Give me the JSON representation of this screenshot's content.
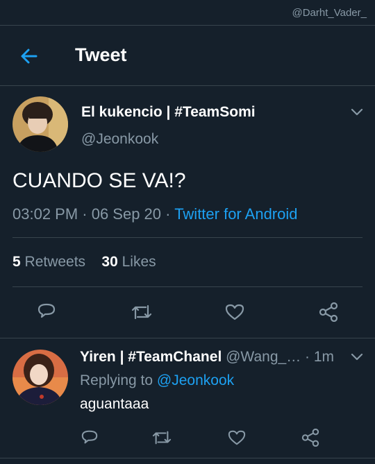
{
  "watermark": "@Darht_Vader_",
  "header": {
    "title": "Tweet"
  },
  "tweet": {
    "author_name": "El kukencio | #TeamSomi",
    "author_handle": "@Jeonkook",
    "text": "CUANDO SE VA!?",
    "timestamp": "03:02 PM · 06 Sep 20 · ",
    "client": "Twitter for Android",
    "retweets_count": "5",
    "retweets_label": " Retweets",
    "likes_count": "30",
    "likes_label": " Likes"
  },
  "reply": {
    "author_name": "Yiren | #TeamChanel",
    "author_handle": " @Wang_…",
    "time": " · 1m",
    "replying_prefix": "Replying to ",
    "replying_to": "@Jeonkook",
    "text": "aguantaaa"
  },
  "icons": {
    "back": "arrow-left-icon",
    "more": "chevron-down-icon",
    "reply": "reply-icon",
    "retweet": "retweet-icon",
    "like": "heart-icon",
    "share": "share-icon"
  },
  "colors": {
    "background": "#15202b",
    "accent": "#1da1f2",
    "secondary_text": "#8899a6",
    "divider": "#38444d"
  }
}
